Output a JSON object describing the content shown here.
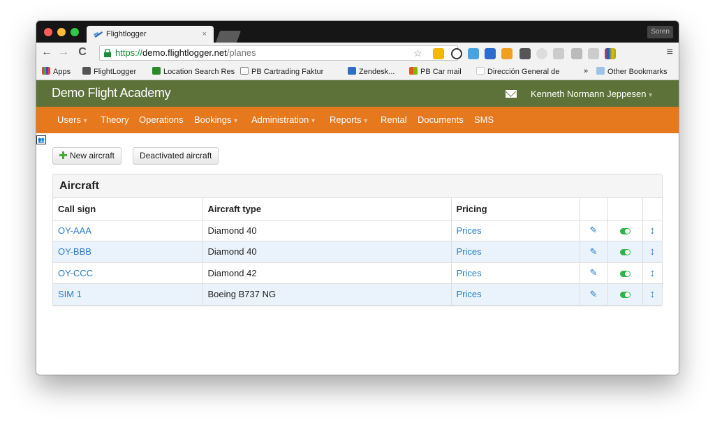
{
  "browser": {
    "tab_title": "Flightlogger",
    "tab_close": "×",
    "profile": "Soren",
    "url_scheme": "https://",
    "url_host": "demo.flightlogger.net",
    "url_path": "/planes",
    "bookmarks": [
      "Apps",
      "FlightLogger",
      "Location Search Res",
      "PB Cartrading Faktur",
      "Zendesk...",
      "PB Car mail",
      "Dirección General de",
      "»",
      "Other Bookmarks"
    ]
  },
  "app": {
    "brand": "Demo Flight Academy",
    "user": "Kenneth Normann Jeppesen",
    "nav": [
      "Users",
      "Theory",
      "Operations",
      "Bookings",
      "Administration",
      "Reports",
      "Rental",
      "Documents",
      "SMS"
    ],
    "caret": "▾"
  },
  "actions": {
    "new_aircraft": "New aircraft",
    "deactivated_aircraft": "Deactivated aircraft"
  },
  "panel": {
    "title": "Aircraft",
    "columns": [
      "Call sign",
      "Aircraft type",
      "Pricing"
    ],
    "rows": [
      {
        "call_sign": "OY-AAA",
        "type": "Diamond 40",
        "pricing": "Prices"
      },
      {
        "call_sign": "OY-BBB",
        "type": "Diamond 40",
        "pricing": "Prices"
      },
      {
        "call_sign": "OY-CCC",
        "type": "Diamond 42",
        "pricing": "Prices"
      },
      {
        "call_sign": "SIM 1",
        "type": "Boeing B737 NG",
        "pricing": "Prices"
      }
    ]
  },
  "colors": {
    "header_green": "#5d7238",
    "nav_orange": "#e6781e",
    "link_blue": "#2a7cc7",
    "toggle_green": "#2db34a",
    "row_alt": "#eaf3fb"
  }
}
